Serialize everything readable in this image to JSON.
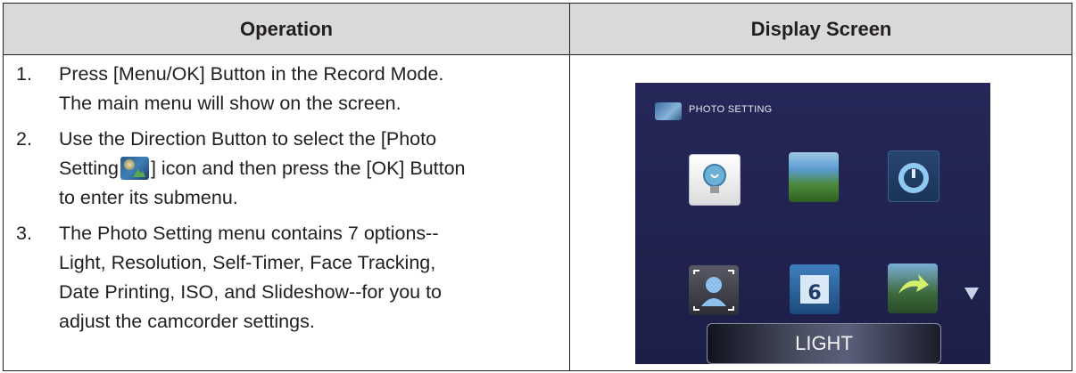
{
  "table": {
    "header_operation": "Operation",
    "header_display": "Display Screen"
  },
  "steps": [
    {
      "num": "1.",
      "line1": "Press [Menu/OK] Button in the Record Mode.",
      "line2": "The main menu will show on the screen."
    },
    {
      "num": "2.",
      "line1": "Use the Direction Button to select the [Photo",
      "line2_pre": "Setting",
      "line2_post": "] icon and then press the [OK] Button",
      "line3": "to enter its submenu."
    },
    {
      "num": "3.",
      "line1": "The Photo Setting menu contains 7 options--",
      "line2": "Light, Resolution, Self-Timer, Face Tracking,",
      "line3": "Date Printing, ISO, and Slideshow--for you to",
      "line4": "adjust the camcorder settings."
    }
  ],
  "screen": {
    "title": "PHOTO SETTING",
    "tiles": [
      "light-icon",
      "resolution-icon",
      "self-timer-icon",
      "face-tracking-icon",
      "date-printing-icon",
      "slideshow-icon"
    ],
    "selected_label": "LIGHT",
    "more_indicator": "down-arrow-icon"
  }
}
